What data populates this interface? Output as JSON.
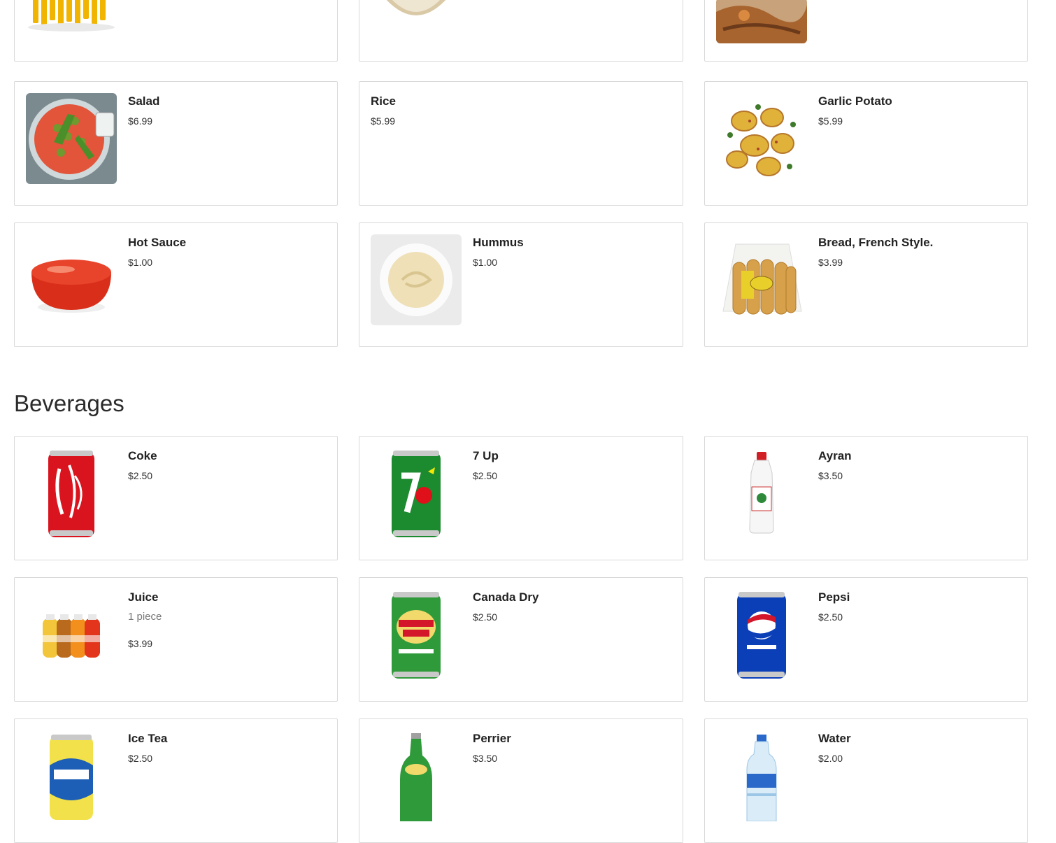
{
  "sections": {
    "beverages_title": "Beverages"
  },
  "sides": [
    {
      "name": "Salad",
      "price": "$6.99"
    },
    {
      "name": "Rice",
      "price": "$5.99"
    },
    {
      "name": "Garlic Potato",
      "price": "$5.99"
    },
    {
      "name": "Hot Sauce",
      "price": "$1.00"
    },
    {
      "name": "Hummus",
      "price": "$1.00"
    },
    {
      "name": "Bread, French Style.",
      "price": "$3.99"
    }
  ],
  "beverages": [
    {
      "name": "Coke",
      "price": "$2.50"
    },
    {
      "name": "7 Up",
      "price": "$2.50"
    },
    {
      "name": "Ayran",
      "price": "$3.50"
    },
    {
      "name": "Juice",
      "description": "1 piece",
      "price": "$3.99"
    },
    {
      "name": "Canada Dry",
      "price": "$2.50"
    },
    {
      "name": "Pepsi",
      "price": "$2.50"
    },
    {
      "name": "Ice Tea",
      "price": "$2.50"
    },
    {
      "name": "Perrier",
      "price": "$3.50"
    },
    {
      "name": "Water",
      "price": "$2.00"
    }
  ],
  "colors": {
    "card_border": "#d9d9d9",
    "text": "#222222",
    "muted": "#777777"
  }
}
